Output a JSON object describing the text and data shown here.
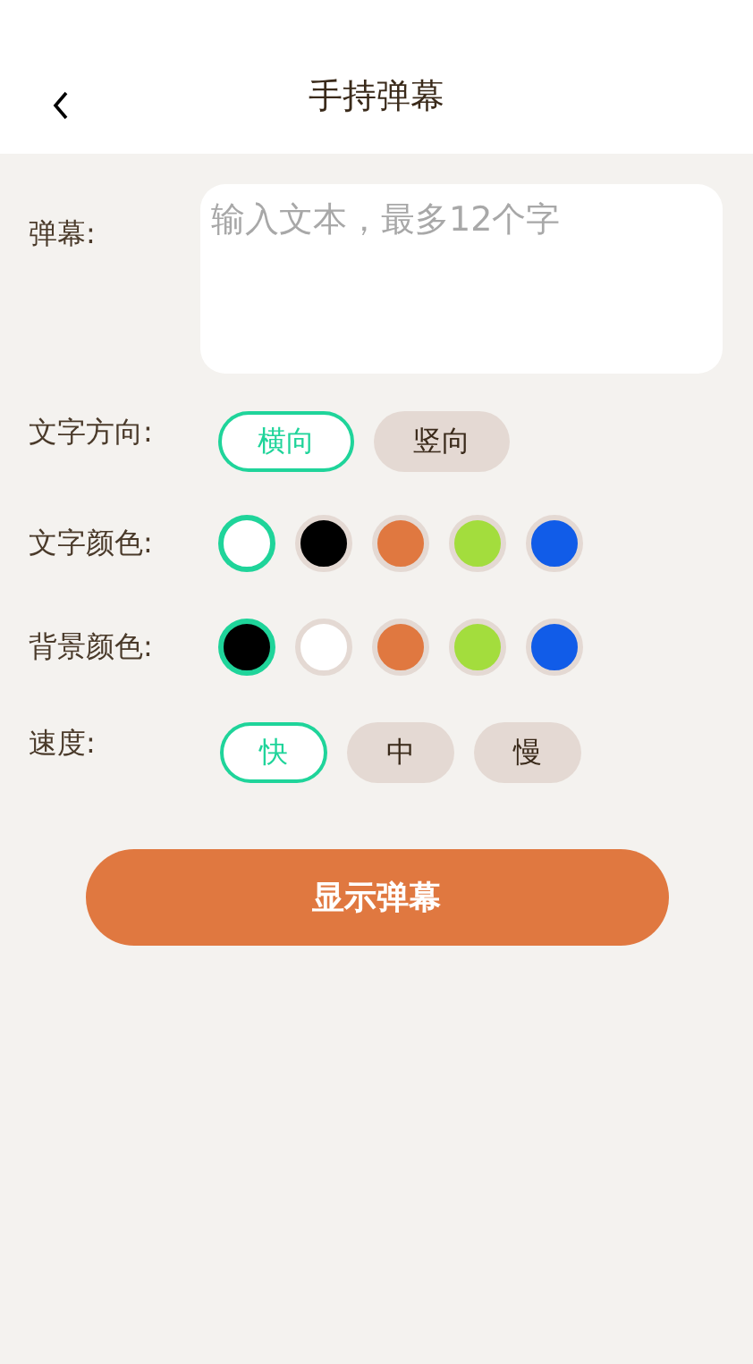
{
  "header": {
    "title": "手持弹幕"
  },
  "text_input": {
    "label": "弹幕:",
    "placeholder": "输入文本，最多12个字"
  },
  "direction": {
    "label": "文字方向:",
    "options": [
      {
        "label": "横向",
        "selected": true
      },
      {
        "label": "竖向",
        "selected": false
      }
    ]
  },
  "text_color": {
    "label": "文字颜色:",
    "swatches": [
      {
        "color": "#ffffff",
        "selected": true
      },
      {
        "color": "#000000",
        "selected": false
      },
      {
        "color": "#e07840",
        "selected": false
      },
      {
        "color": "#a3dd3d",
        "selected": false
      },
      {
        "color": "#115ce8",
        "selected": false
      }
    ]
  },
  "background_color": {
    "label": "背景颜色:",
    "swatches": [
      {
        "color": "#000000",
        "selected": true
      },
      {
        "color": "#ffffff",
        "selected": false
      },
      {
        "color": "#e07840",
        "selected": false
      },
      {
        "color": "#a3dd3d",
        "selected": false
      },
      {
        "color": "#115ce8",
        "selected": false
      }
    ]
  },
  "speed": {
    "label": "速度:",
    "options": [
      {
        "label": "快",
        "selected": true
      },
      {
        "label": "中",
        "selected": false
      },
      {
        "label": "慢",
        "selected": false
      }
    ]
  },
  "submit_button": {
    "label": "显示弹幕"
  }
}
